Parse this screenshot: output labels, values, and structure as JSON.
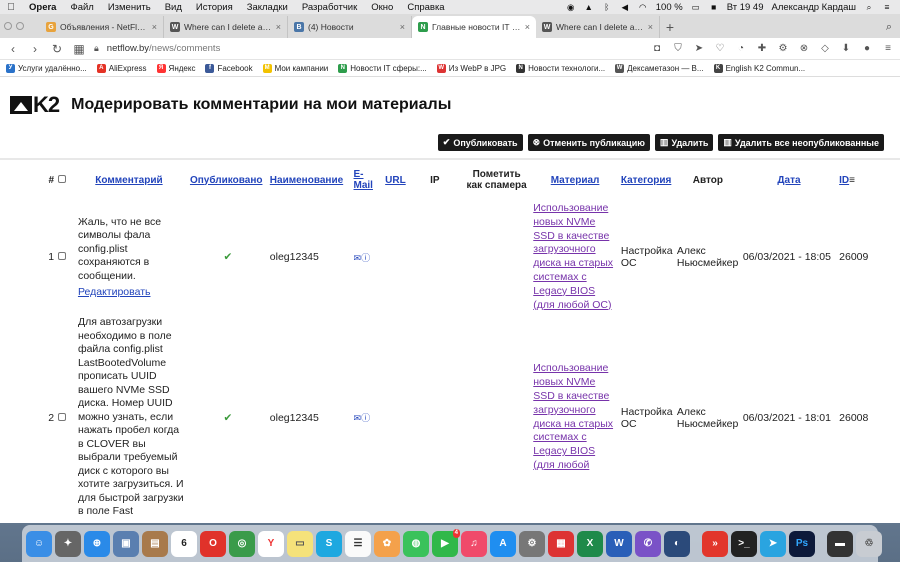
{
  "menubar": {
    "app_name": "Opera",
    "items": [
      "Файл",
      "Изменить",
      "Вид",
      "История",
      "Закладки",
      "Разработчик",
      "Окно",
      "Справка"
    ],
    "battery": "100 %",
    "clock": "Вт 19 49",
    "user": "Александр Кардаш"
  },
  "tabs": [
    {
      "title": "Объявления - NetFlow - Goog",
      "active": false,
      "fav_color": "#e8a33d",
      "fav_letter": "G"
    },
    {
      "title": "Where can I delete a template",
      "active": false,
      "fav_color": "#555555",
      "fav_letter": "W"
    },
    {
      "title": "(4) Новости",
      "active": false,
      "fav_color": "#4a76a8",
      "fav_letter": "B"
    },
    {
      "title": "Главные новости IT сферы: к",
      "active": true,
      "fav_color": "#2e9d4c",
      "fav_letter": "N"
    },
    {
      "title": "Where can I delete a template",
      "active": false,
      "fav_color": "#555555",
      "fav_letter": "W"
    }
  ],
  "address": {
    "host": "netflow.by",
    "path": "/news/comments"
  },
  "bookmarks": [
    {
      "label": "Услуги удалённо...",
      "color": "#2a72c9",
      "letter": "У"
    },
    {
      "label": "AliExpress",
      "color": "#e43225",
      "letter": "A"
    },
    {
      "label": "Яндекс",
      "color": "#ff3333",
      "letter": "Я"
    },
    {
      "label": "Facebook",
      "color": "#3b5998",
      "letter": "f"
    },
    {
      "label": "Мои кампании",
      "color": "#f2c200",
      "letter": "M"
    },
    {
      "label": "Новости IT сферы:...",
      "color": "#2e9d4c",
      "letter": "N"
    },
    {
      "label": "Из WebP в JPG",
      "color": "#d33",
      "letter": "W"
    },
    {
      "label": "Новости технологи...",
      "color": "#333",
      "letter": "N"
    },
    {
      "label": "Дексаметазон — В...",
      "color": "#555",
      "letter": "W"
    },
    {
      "label": "English K2 Commun...",
      "color": "#444",
      "letter": "K"
    }
  ],
  "page": {
    "logo_text": "K2",
    "title": "Модерировать комментарии на мои материалы"
  },
  "toolbar": {
    "publish": "Опубликовать",
    "unpublish": "Отменить публикацию",
    "delete": "Удалить",
    "delete_unpublished": "Удалить все неопубликованные"
  },
  "table": {
    "headers": {
      "num": "#",
      "comment": "Комментарий",
      "published": "Опубликовано",
      "name": "Наименование",
      "email": "E-Mail",
      "url": "URL",
      "ip": "IP",
      "spam": "Пометить как спамера",
      "material": "Материал",
      "category": "Категория",
      "author": "Автор",
      "date": "Дата",
      "id": "ID"
    },
    "rows": [
      {
        "num": "1",
        "comment": "Жаль, что не все символы фала config.plist сохраняются в сообщении.",
        "edit": "Редактировать",
        "name": "oleg12345",
        "material": "Использование новых NVMe SSD в качестве загрузочного диска на старых системах с Legacy BIOS (для любой ОС)",
        "category": "Настройка ОС",
        "author": "Алекс Ньюсмейкер",
        "date": "06/03/2021 - 18:05",
        "id": "26009"
      },
      {
        "num": "2",
        "comment": "Для автозагрузки необходимо в поле файла config.plist LastBootedVolume прописать UUID вашего NVMe SSD диска. Номер UUID можно узнать, если нажать пробел когда в CLOVER вы выбрали требуемый диск с которого вы хотите загрузиться. И для быстрой загрузки в поле Fast",
        "edit": "",
        "name": "oleg12345",
        "material": "Использование новых NVMe SSD в качестве загрузочного диска на старых системах с Legacy BIOS (для любой",
        "category": "Настройка ОС",
        "author": "Алекс Ньюсмейкер",
        "date": "06/03/2021 - 18:01",
        "id": "26008"
      }
    ]
  },
  "dock": {
    "calendar_day": "6",
    "telegram_badge": "4"
  }
}
